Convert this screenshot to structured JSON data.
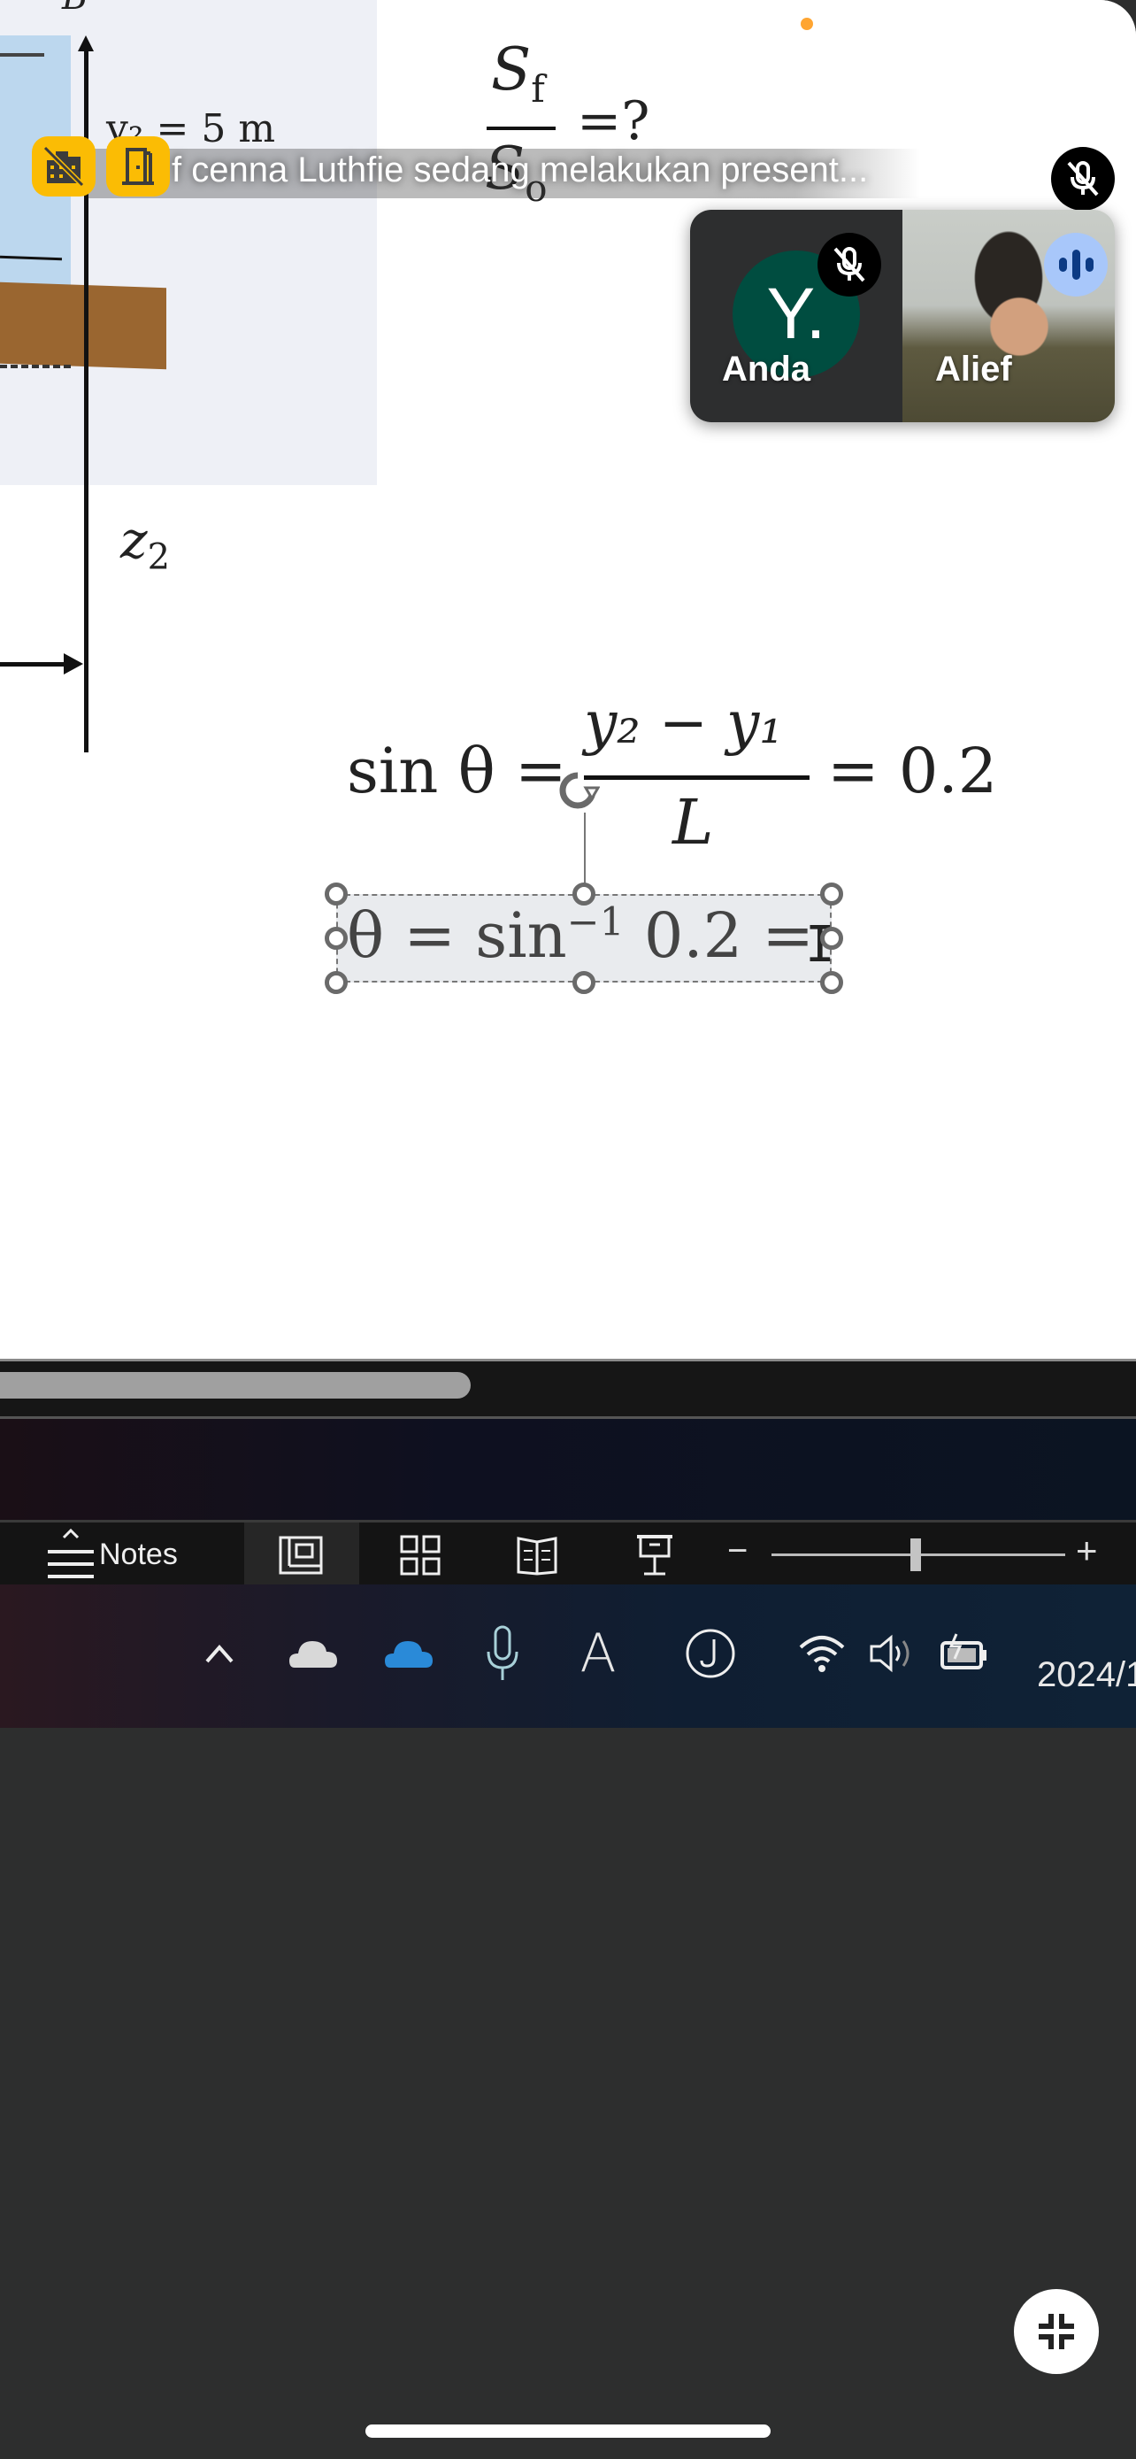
{
  "meet": {
    "presenter_banner": "f...cenna Luthfie sedang melakukan present...",
    "presenter_banner_visible": "f  cenna Luthfie sedang melakukan present...",
    "badges": [
      "building-off-icon",
      "door-icon"
    ],
    "self_tile": {
      "initial": "Y.",
      "name": "Anda",
      "mic": "muted"
    },
    "other_tile": {
      "name": "Alief",
      "audio": "speaking"
    },
    "top_mic_state": "muted",
    "colors": {
      "badge": "#fbbc04",
      "avatar": "#004d40",
      "speaking": "#a8c7fa",
      "recording_dot": "#ffa531"
    }
  },
  "slide": {
    "diagram": {
      "top_label": "B",
      "y2_label": "y₂ = 5 m",
      "z2_label": "z",
      "z2_sub": "2"
    },
    "ratio": {
      "num": "S",
      "num_sub": "f",
      "den": "S",
      "den_sub": "o",
      "rhs": "=?"
    },
    "eq1": {
      "lhs": "sin θ =",
      "numerator": "y₂ − y₁",
      "denominator": "L",
      "rhs": "= 0.2"
    },
    "eq2": {
      "part1": "θ = sin",
      "sup": "−1",
      "part2": " 0.2 =",
      "selected": true
    }
  },
  "powerpoint": {
    "notes_label": "Notes",
    "views": [
      "normal-view",
      "slide-sorter",
      "reading-view",
      "slideshow"
    ],
    "active_view": "normal-view",
    "zoom_minus": "−",
    "zoom_plus": "+",
    "zoom_level_fraction": 0.49
  },
  "taskbar": {
    "tray_icons": [
      "chevron-up-icon",
      "onedrive-gray-icon",
      "onedrive-blue-icon",
      "microphone-icon",
      "ime-font-icon",
      "j-app-icon",
      "wifi-icon",
      "volume-icon",
      "battery-charging-icon"
    ],
    "ime_label": "A",
    "j_label": "J",
    "date": "2024/1"
  }
}
